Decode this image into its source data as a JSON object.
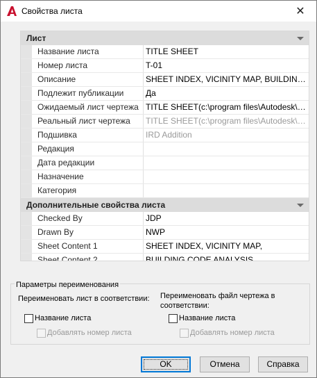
{
  "window": {
    "title": "Свойства листа",
    "close_glyph": "✕"
  },
  "sheet_section": {
    "title": "Лист",
    "rows": [
      {
        "label": "Название листа",
        "value": "TITLE SHEET",
        "dim": false
      },
      {
        "label": "Номер листа",
        "value": "T-01",
        "dim": false
      },
      {
        "label": "Описание",
        "value": "SHEET INDEX,  VICINITY  MAP,  BUILDING...",
        "dim": false
      },
      {
        "label": "Подлежит публикации",
        "value": "Да",
        "dim": false
      },
      {
        "label": "Ожидаемый лист чертежа",
        "value": "TITLE  SHEET(c:\\program  files\\Autodesk\\a...",
        "dim": false
      },
      {
        "label": "Реальный лист чертежа",
        "value": "TITLE  SHEET(c:\\program  files\\Autodesk\\a...",
        "dim": true
      },
      {
        "label": "Подшивка",
        "value": "IRD Addition",
        "dim": true
      },
      {
        "label": "Редакция",
        "value": "",
        "dim": false
      },
      {
        "label": "Дата редакции",
        "value": "",
        "dim": false
      },
      {
        "label": "Назначение",
        "value": "",
        "dim": false
      },
      {
        "label": "Категория",
        "value": "",
        "dim": false
      }
    ]
  },
  "extra_section": {
    "title": "Дополнительные свойства листа",
    "rows": [
      {
        "label": "Checked By",
        "value": "JDP"
      },
      {
        "label": "Drawn By",
        "value": "NWP"
      },
      {
        "label": "Sheet Content 1",
        "value": "SHEET INDEX, VICINITY MAP,"
      },
      {
        "label": "Sheet Content 2",
        "value": "BUILDING CODE ANALYSIS"
      }
    ]
  },
  "rename": {
    "group_title": "Параметры переименования",
    "left_heading": "Переименовать лист в соответствии:",
    "right_heading": "Переименовать файл чертежа в соответствии:",
    "left_sheet_name": "Название листа",
    "left_add_number": "Добавлять номер листа",
    "right_sheet_name": "Название листа",
    "right_add_number": "Добавлять номер листа"
  },
  "buttons": {
    "ok": "OK",
    "cancel": "Отмена",
    "help": "Справка"
  },
  "colors": {
    "accent": "#0078d7",
    "app_icon": "#c8102e"
  }
}
